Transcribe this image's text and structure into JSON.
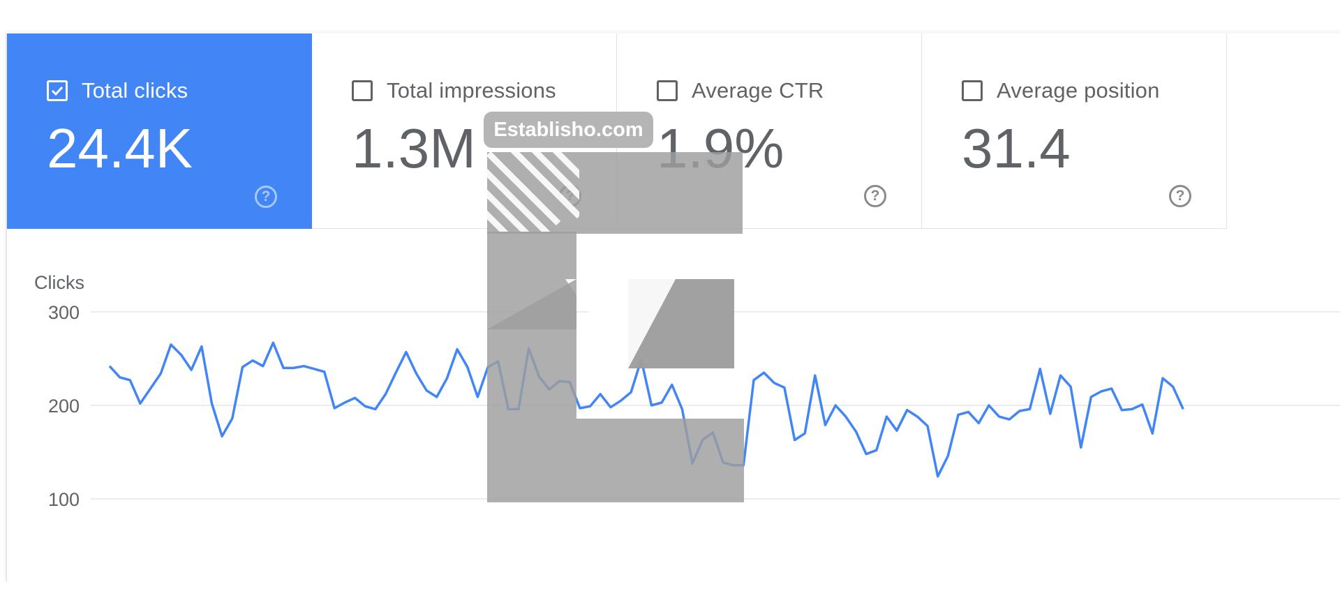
{
  "cards": [
    {
      "label": "Total clicks",
      "value": "24.4K",
      "selected": true
    },
    {
      "label": "Total impressions",
      "value": "1.3M",
      "selected": false
    },
    {
      "label": "Average CTR",
      "value": "1.9%",
      "selected": false
    },
    {
      "label": "Average position",
      "value": "31.4",
      "selected": false
    }
  ],
  "help_glyph": "?",
  "colors": {
    "accent": "#4285f4",
    "line": "#4285f4",
    "text": "#5f6368"
  },
  "icons": {
    "checkbox_checked": "check-icon",
    "help": "help-circle-icon"
  },
  "watermark": {
    "text": "Establisho.com"
  },
  "chart_data": {
    "type": "line",
    "ylabel": "Clicks",
    "ylim": [
      100,
      300
    ],
    "yticks": [
      300,
      200,
      100
    ],
    "grid": true,
    "series": [
      {
        "values": [
          242,
          230,
          227,
          202,
          218,
          234,
          265,
          254,
          238,
          263,
          202,
          167,
          186,
          241,
          248,
          242,
          267,
          240,
          240,
          242,
          239,
          236,
          197,
          203,
          208,
          199,
          196,
          212,
          235,
          257,
          234,
          216,
          209,
          229,
          260,
          241,
          209,
          241,
          247,
          196,
          196,
          261,
          231,
          217,
          226,
          225,
          197,
          199,
          212,
          198,
          205,
          214,
          249,
          200,
          203,
          222,
          196,
          138,
          163,
          171,
          139,
          136,
          136,
          227,
          235,
          224,
          219,
          163,
          170,
          232,
          179,
          200,
          188,
          172,
          148,
          152,
          188,
          173,
          195,
          188,
          178,
          124,
          146,
          190,
          193,
          181,
          200,
          188,
          185,
          194,
          196,
          239,
          191,
          232,
          220,
          155,
          209,
          215,
          218,
          195,
          196,
          201,
          170,
          229,
          220,
          196
        ]
      }
    ]
  }
}
